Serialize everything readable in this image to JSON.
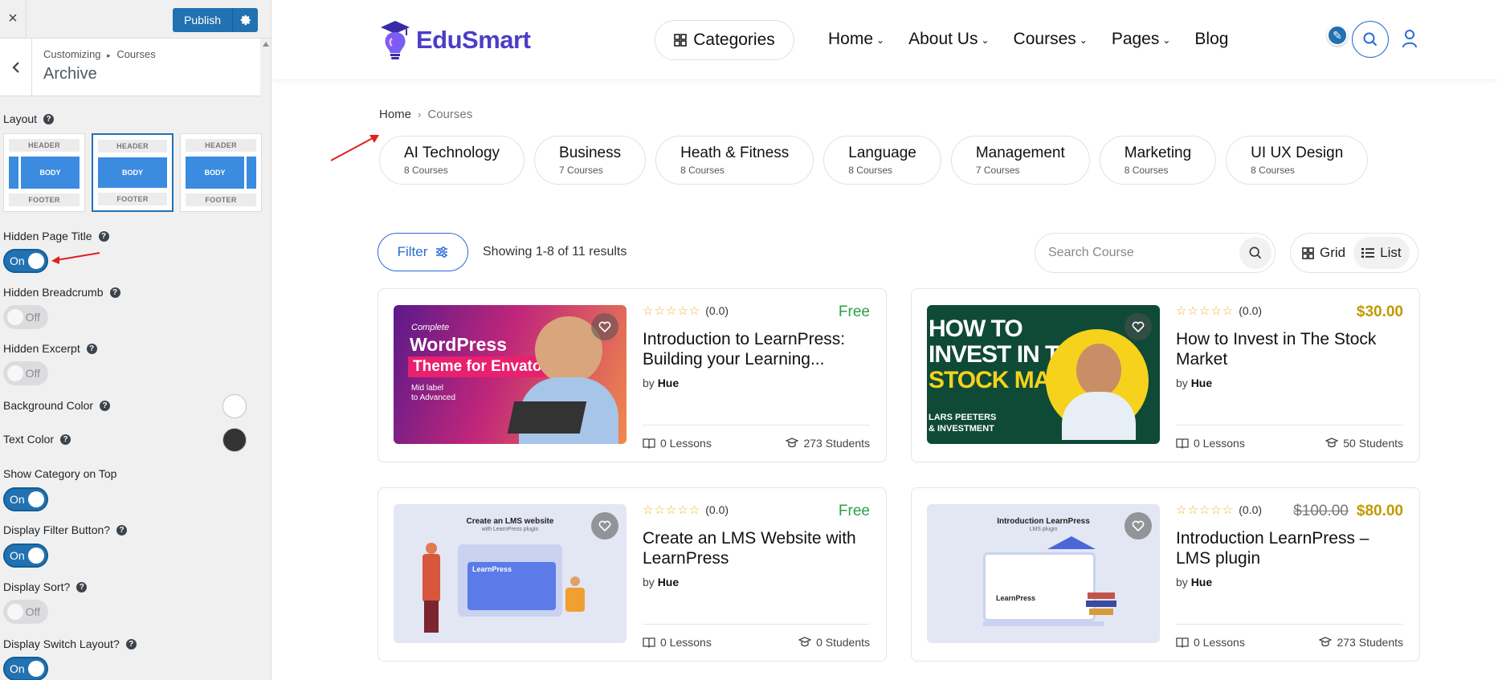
{
  "customizer": {
    "close": "×",
    "publish_label": "Publish",
    "breadcrumb_root": "Customizing",
    "breadcrumb_sep": "▸",
    "breadcrumb_section": "Courses",
    "panel_title": "Archive",
    "layout_label": "Layout",
    "layout_options": [
      {
        "header": "HEADER",
        "body": "BODY",
        "footer": "FOOTER"
      },
      {
        "header": "HEADER",
        "body": "BODY",
        "footer": "FOOTER"
      },
      {
        "header": "HEADER",
        "body": "BODY",
        "footer": "FOOTER"
      }
    ],
    "settings": {
      "hidden_page_title": {
        "label": "Hidden Page Title",
        "state": "On"
      },
      "hidden_breadcrumb": {
        "label": "Hidden Breadcrumb",
        "state": "Off"
      },
      "hidden_excerpt": {
        "label": "Hidden Excerpt",
        "state": "Off"
      },
      "background_color": {
        "label": "Background Color",
        "color": "#ffffff"
      },
      "text_color": {
        "label": "Text Color",
        "color": "#333333"
      },
      "show_category_on_top": {
        "label": "Show Category on Top",
        "state": "On"
      },
      "display_filter_button": {
        "label": "Display Filter Button?",
        "state": "On"
      },
      "display_sort": {
        "label": "Display Sort?",
        "state": "Off"
      },
      "display_switch_layout": {
        "label": "Display Switch Layout?",
        "state": "On"
      }
    }
  },
  "site": {
    "logo_text": "EduSmart",
    "categories_button": "Categories",
    "nav": [
      "Home",
      "About Us",
      "Courses",
      "Pages",
      "Blog"
    ],
    "nav_has_dropdown": [
      true,
      true,
      true,
      true,
      false
    ]
  },
  "breadcrumb": {
    "home": "Home",
    "current": "Courses"
  },
  "category_pills": [
    {
      "name": "AI Technology",
      "count": "8 Courses"
    },
    {
      "name": "Business",
      "count": "7 Courses"
    },
    {
      "name": "Heath & Fitness",
      "count": "8 Courses"
    },
    {
      "name": "Language",
      "count": "8 Courses"
    },
    {
      "name": "Management",
      "count": "7 Courses"
    },
    {
      "name": "Marketing",
      "count": "8 Courses"
    },
    {
      "name": "UI UX Design",
      "count": "8 Courses"
    }
  ],
  "toolbar": {
    "filter_label": "Filter",
    "showing_text": "Showing 1-8 of 11 results",
    "search_placeholder": "Search Course",
    "grid_label": "Grid",
    "list_label": "List"
  },
  "courses": [
    {
      "rating": "(0.0)",
      "price": "Free",
      "old_price": "",
      "title": "Introduction to LearnPress: Building your Learning...",
      "by": "by",
      "author": "Hue",
      "lessons": "0 Lessons",
      "students": "273 Students",
      "thumb": {
        "line1": "Complete",
        "line2": "WordPress",
        "line3": "Theme for Envato",
        "line4": "Mid label",
        "line5": "to Advanced"
      }
    },
    {
      "rating": "(0.0)",
      "price": "$30.00",
      "old_price": "",
      "title": "How to Invest in The Stock Market",
      "by": "by",
      "author": "Hue",
      "lessons": "0 Lessons",
      "students": "50 Students",
      "thumb": {
        "line1": "HOW TO",
        "line2": "INVEST IN THE",
        "line3": "STOCK MARKET",
        "line4": "LARS PEETERS",
        "line5": "& INVESTMENT"
      }
    },
    {
      "rating": "(0.0)",
      "price": "Free",
      "old_price": "",
      "title": "Create an LMS Website with LearnPress",
      "by": "by",
      "author": "Hue",
      "lessons": "0 Lessons",
      "students": "0 Students",
      "thumb": {
        "line1": "Create an LMS website",
        "line2": "with LearnPress plugin",
        "line3": "LearnPress"
      }
    },
    {
      "rating": "(0.0)",
      "price": "$80.00",
      "old_price": "$100.00",
      "title": "Introduction LearnPress – LMS plugin",
      "by": "by",
      "author": "Hue",
      "lessons": "0 Lessons",
      "students": "273 Students",
      "thumb": {
        "line1": "Introduction LearnPress",
        "line2": "LMS plugin",
        "line3": "LearnPress"
      }
    }
  ],
  "colors": {
    "wp_blue": "#2271b1",
    "brand_purple": "#4d3cc7",
    "accent_blue": "#2a6ad6",
    "free_green": "#2da046",
    "price_gold": "#c19a00",
    "annotation_red": "#e02020"
  }
}
